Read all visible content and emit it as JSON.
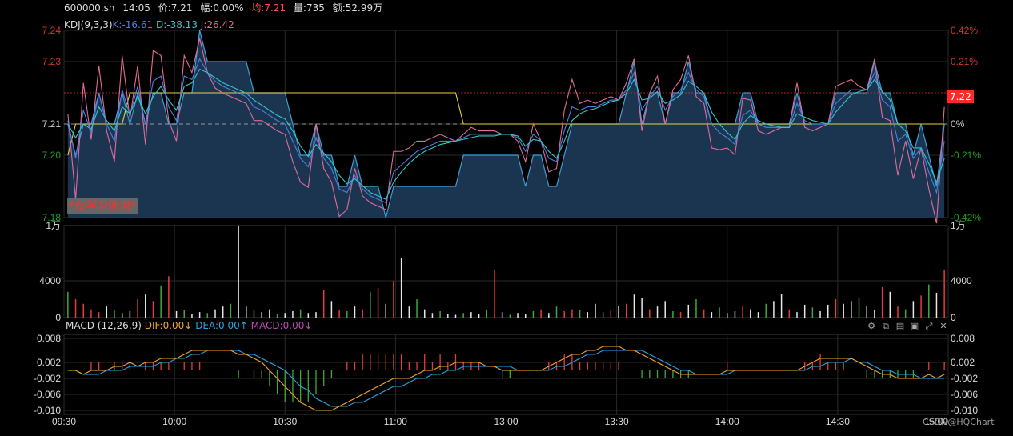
{
  "header": {
    "symbol": "600000.sh",
    "time": "14:05",
    "price": "价:7.21",
    "change": "幅:0.00%",
    "avg": "均:7.21",
    "volume": "量:735",
    "amount": "额:52.99万"
  },
  "kdj": {
    "title": "KDJ(9,3,3)",
    "k": "K:-16.61",
    "d": "D:-38.13",
    "j": "J:26.42"
  },
  "macd": {
    "title": "MACD (12,26,9)",
    "dif": "DIF:0.00↓",
    "dea": "DEA:0.00↑",
    "macd": "MACD:0.00↓"
  },
  "watermark": "*仅学习使用*",
  "price_tag": "7.22",
  "credit": "CSDN@HQChart",
  "toolbar_icons": [
    "settings-icon",
    "copy-icon",
    "layers-icon",
    "window-icon",
    "expand-icon",
    "close-icon"
  ],
  "colors": {
    "area_fill": "#1b3551",
    "area_line": "#3aa0d8",
    "avg_line": "#e6d23c",
    "k": "#4f7fe0",
    "d": "#33c9c9",
    "j": "#e06c9a",
    "dif": "#f4a62a",
    "dea": "#2aa6e8",
    "up": "#e83b3b",
    "down": "#3fa83f",
    "grid": "#2a2a2a",
    "up_text": "#e03030",
    "down_text": "#21a121"
  },
  "chart_data": [
    {
      "type": "area",
      "name": "price",
      "yticks_left": [
        "7.24",
        "7.23",
        "7.21",
        "7.20",
        "7.18"
      ],
      "yticks_right": [
        "0.42%",
        "0.21%",
        "0%",
        "-0.21%",
        "-0.42%"
      ],
      "ylim": [
        7.18,
        7.24
      ],
      "prev_close": 7.21,
      "last_price_line": 7.22,
      "xticks": [
        "09:30",
        "10:00",
        "10:30",
        "11:00",
        "13:00",
        "13:30",
        "14:00",
        "14:30",
        "15:00"
      ],
      "price": [
        7.21,
        7.2,
        7.21,
        7.21,
        7.22,
        7.21,
        7.21,
        7.22,
        7.21,
        7.22,
        7.21,
        7.22,
        7.22,
        7.21,
        7.21,
        7.22,
        7.22,
        7.24,
        7.23,
        7.23,
        7.23,
        7.23,
        7.23,
        7.23,
        7.22,
        7.22,
        7.22,
        7.22,
        7.22,
        7.21,
        7.2,
        7.2,
        7.21,
        7.2,
        7.2,
        7.19,
        7.19,
        7.2,
        7.19,
        7.19,
        7.19,
        7.18,
        7.19,
        7.19,
        7.19,
        7.19,
        7.19,
        7.19,
        7.19,
        7.19,
        7.19,
        7.2,
        7.2,
        7.2,
        7.2,
        7.2,
        7.2,
        7.2,
        7.2,
        7.19,
        7.2,
        7.2,
        7.19,
        7.19,
        7.2,
        7.21,
        7.21,
        7.21,
        7.21,
        7.21,
        7.21,
        7.21,
        7.22,
        7.23,
        7.21,
        7.22,
        7.22,
        7.21,
        7.22,
        7.22,
        7.23,
        7.22,
        7.22,
        7.21,
        7.21,
        7.21,
        7.21,
        7.22,
        7.22,
        7.21,
        7.21,
        7.21,
        7.21,
        7.21,
        7.22,
        7.21,
        7.21,
        7.21,
        7.21,
        7.22,
        7.22,
        7.22,
        7.22,
        7.22,
        7.23,
        7.22,
        7.22,
        7.21,
        7.21,
        7.2,
        7.21,
        7.2,
        7.19,
        7.21
      ],
      "avg_price": [
        7.2,
        7.21,
        7.21,
        7.21,
        7.21,
        7.21,
        7.21,
        7.21,
        7.22,
        7.22,
        7.22,
        7.22,
        7.22,
        7.22,
        7.22,
        7.22,
        7.22,
        7.22,
        7.22,
        7.22,
        7.22,
        7.22,
        7.22,
        7.22,
        7.22,
        7.22,
        7.22,
        7.22,
        7.22,
        7.22,
        7.22,
        7.22,
        7.22,
        7.22,
        7.22,
        7.22,
        7.22,
        7.22,
        7.22,
        7.22,
        7.22,
        7.22,
        7.22,
        7.22,
        7.22,
        7.22,
        7.22,
        7.22,
        7.22,
        7.22,
        7.22,
        7.21,
        7.21,
        7.21,
        7.21,
        7.21,
        7.21,
        7.21,
        7.21,
        7.21,
        7.21,
        7.21,
        7.21,
        7.21,
        7.21,
        7.21,
        7.21,
        7.21,
        7.21,
        7.21,
        7.21,
        7.21,
        7.21,
        7.21,
        7.21,
        7.21,
        7.21,
        7.21,
        7.21,
        7.21,
        7.21,
        7.21,
        7.21,
        7.21,
        7.21,
        7.21,
        7.21,
        7.21,
        7.21,
        7.21,
        7.21,
        7.21,
        7.21,
        7.21,
        7.21,
        7.21,
        7.21,
        7.21,
        7.21,
        7.21,
        7.21,
        7.21,
        7.21,
        7.21,
        7.21,
        7.21,
        7.21,
        7.21,
        7.21,
        7.21,
        7.21,
        7.21,
        7.21,
        7.21
      ],
      "kdj_k": [
        52,
        30,
        58,
        45,
        68,
        50,
        40,
        70,
        55,
        72,
        50,
        75,
        78,
        60,
        52,
        78,
        76,
        88,
        80,
        75,
        72,
        70,
        68,
        66,
        60,
        58,
        55,
        52,
        50,
        40,
        30,
        25,
        42,
        30,
        24,
        12,
        10,
        20,
        12,
        8,
        6,
        4,
        22,
        26,
        30,
        34,
        36,
        38,
        40,
        40,
        40,
        42,
        44,
        44,
        44,
        44,
        44,
        44,
        42,
        34,
        44,
        40,
        30,
        28,
        46,
        60,
        58,
        60,
        60,
        62,
        64,
        64,
        70,
        80,
        58,
        66,
        72,
        58,
        66,
        70,
        80,
        70,
        66,
        50,
        45,
        42,
        38,
        55,
        58,
        50,
        48,
        48,
        48,
        48,
        62,
        52,
        50,
        50,
        50,
        62,
        66,
        70,
        70,
        70,
        80,
        64,
        60,
        40,
        44,
        30,
        36,
        22,
        10,
        40
      ],
      "kdj_d": [
        50,
        42,
        50,
        47,
        60,
        52,
        46,
        60,
        56,
        66,
        56,
        66,
        72,
        64,
        58,
        72,
        74,
        82,
        80,
        77,
        74,
        72,
        70,
        68,
        64,
        61,
        58,
        55,
        53,
        46,
        37,
        31,
        38,
        33,
        28,
        20,
        15,
        18,
        14,
        10,
        8,
        6,
        16,
        22,
        27,
        31,
        34,
        36,
        38,
        39,
        40,
        41,
        42,
        43,
        43,
        43,
        44,
        44,
        43,
        37,
        41,
        40,
        34,
        30,
        40,
        52,
        56,
        58,
        59,
        61,
        63,
        64,
        68,
        76,
        64,
        65,
        69,
        62,
        64,
        67,
        75,
        72,
        68,
        57,
        50,
        45,
        41,
        50,
        55,
        52,
        50,
        49,
        48,
        48,
        56,
        54,
        52,
        51,
        50,
        57,
        62,
        67,
        69,
        70,
        76,
        69,
        64,
        50,
        46,
        36,
        36,
        27,
        16,
        30
      ],
      "kdj_j": [
        56,
        6,
        74,
        41,
        84,
        46,
        28,
        90,
        53,
        84,
        38,
        93,
        90,
        52,
        40,
        90,
        80,
        100,
        80,
        71,
        68,
        66,
        64,
        62,
        52,
        52,
        49,
        46,
        44,
        28,
        16,
        13,
        50,
        24,
        16,
        -4,
        0,
        24,
        8,
        4,
        2,
        0,
        34,
        34,
        36,
        40,
        40,
        42,
        44,
        42,
        40,
        44,
        48,
        46,
        46,
        46,
        44,
        44,
        40,
        28,
        50,
        40,
        22,
        24,
        58,
        76,
        62,
        64,
        62,
        64,
        66,
        64,
        74,
        88,
        46,
        68,
        78,
        50,
        70,
        76,
        90,
        66,
        62,
        36,
        35,
        36,
        32,
        65,
        64,
        46,
        44,
        46,
        48,
        48,
        74,
        48,
        46,
        48,
        50,
        72,
        74,
        76,
        72,
        70,
        88,
        54,
        52,
        20,
        40,
        18,
        36,
        12,
        -8,
        60
      ]
    },
    {
      "type": "bar",
      "name": "volume",
      "yticks": [
        "1万",
        "4000",
        "0"
      ],
      "ylim": [
        0,
        10000
      ],
      "values": [
        2800,
        2000,
        1500,
        900,
        600,
        1200,
        800,
        500,
        700,
        2000,
        2500,
        1800,
        3500,
        4500,
        700,
        800,
        400,
        600,
        500,
        900,
        1200,
        1500,
        10000,
        1200,
        800,
        600,
        900,
        400,
        500,
        700,
        900,
        500,
        600,
        3000,
        1800,
        800,
        700,
        1200,
        900,
        2800,
        3200,
        1500,
        4000,
        6500,
        1200,
        2000,
        900,
        500,
        700,
        400,
        300,
        500,
        600,
        400,
        800,
        5200,
        600,
        300,
        500,
        400,
        700,
        900,
        500,
        1200,
        700,
        900,
        800,
        600,
        1500,
        600,
        800,
        1300,
        1500,
        2500,
        2100,
        900,
        1200,
        1800,
        700,
        600,
        1400,
        2000,
        900,
        600,
        1100,
        500,
        700,
        1300,
        900,
        600,
        1500,
        1800,
        2600,
        900,
        600,
        1400,
        1100,
        700,
        1400,
        2000,
        1500,
        1800,
        2200,
        1300,
        800,
        3300,
        2800,
        1200,
        900,
        1800,
        2400,
        3600,
        2700,
        5200
      ],
      "up": [
        false,
        true,
        true,
        true,
        true,
        false,
        false,
        false,
        false,
        true,
        false,
        true,
        false,
        true,
        false,
        false,
        false,
        false,
        false,
        false,
        false,
        false,
        false,
        false,
        false,
        false,
        false,
        false,
        false,
        false,
        false,
        false,
        false,
        true,
        false,
        true,
        false,
        false,
        true,
        false,
        true,
        false,
        true,
        false,
        false,
        false,
        false,
        false,
        false,
        false,
        false,
        false,
        false,
        false,
        false,
        true,
        false,
        false,
        false,
        false,
        false,
        true,
        false,
        false,
        true,
        true,
        false,
        false,
        false,
        false,
        true,
        false,
        true,
        false,
        false,
        true,
        false,
        false,
        false,
        true,
        false,
        false,
        true,
        false,
        false,
        false,
        false,
        true,
        false,
        false,
        false,
        false,
        false,
        true,
        false,
        false,
        false,
        false,
        false,
        true,
        false,
        false,
        false,
        false,
        false,
        true,
        false,
        true,
        false,
        false,
        true,
        false,
        false,
        true
      ]
    },
    {
      "type": "line",
      "name": "macd",
      "yticks": [
        "0.008",
        "0.002",
        "-0.002",
        "-0.006",
        "-0.010"
      ],
      "ylim": [
        -0.011,
        0.009
      ],
      "dif": [
        0.0,
        0.0,
        -0.001,
        0.0,
        0.0,
        0.0,
        0.001,
        0.001,
        0.002,
        0.001,
        0.002,
        0.002,
        0.003,
        0.003,
        0.003,
        0.004,
        0.005,
        0.005,
        0.005,
        0.005,
        0.005,
        0.005,
        0.004,
        0.004,
        0.003,
        0.002,
        0.0,
        -0.002,
        -0.004,
        -0.006,
        -0.008,
        -0.009,
        -0.01,
        -0.01,
        -0.01,
        -0.009,
        -0.008,
        -0.007,
        -0.006,
        -0.005,
        -0.004,
        -0.003,
        -0.002,
        -0.002,
        -0.002,
        -0.001,
        0.0,
        0.0,
        0.001,
        0.001,
        0.002,
        0.002,
        0.002,
        0.002,
        0.001,
        0.001,
        0.0,
        0.0,
        0.0,
        0.0,
        0.0,
        0.0,
        0.001,
        0.002,
        0.003,
        0.004,
        0.004,
        0.005,
        0.005,
        0.006,
        0.006,
        0.006,
        0.005,
        0.005,
        0.004,
        0.003,
        0.002,
        0.001,
        0.0,
        -0.001,
        -0.001,
        -0.001,
        -0.001,
        -0.001,
        -0.001,
        0.0,
        0.0,
        0.0,
        0.0,
        0.0,
        0.0,
        0.0,
        0.0,
        0.0,
        0.0,
        0.001,
        0.002,
        0.003,
        0.003,
        0.003,
        0.003,
        0.003,
        0.002,
        0.001,
        0.0,
        -0.001,
        -0.001,
        -0.002,
        -0.002,
        -0.002,
        -0.002,
        -0.001,
        -0.002,
        -0.001
      ],
      "dea": [
        0.0,
        0.0,
        -0.001,
        -0.001,
        -0.001,
        0.0,
        0.0,
        0.0,
        0.001,
        0.001,
        0.001,
        0.001,
        0.002,
        0.002,
        0.003,
        0.003,
        0.004,
        0.004,
        0.005,
        0.005,
        0.005,
        0.005,
        0.005,
        0.004,
        0.004,
        0.003,
        0.002,
        0.001,
        0.0,
        -0.002,
        -0.004,
        -0.005,
        -0.007,
        -0.008,
        -0.009,
        -0.009,
        -0.009,
        -0.008,
        -0.008,
        -0.007,
        -0.006,
        -0.005,
        -0.004,
        -0.004,
        -0.003,
        -0.002,
        -0.002,
        -0.001,
        -0.001,
        0.0,
        0.0,
        0.001,
        0.001,
        0.001,
        0.001,
        0.001,
        0.001,
        0.001,
        0.0,
        0.0,
        0.0,
        0.0,
        0.0,
        0.001,
        0.001,
        0.002,
        0.003,
        0.004,
        0.004,
        0.005,
        0.005,
        0.005,
        0.005,
        0.005,
        0.005,
        0.004,
        0.003,
        0.002,
        0.001,
        0.0,
        0.0,
        -0.001,
        -0.001,
        -0.001,
        -0.001,
        -0.001,
        0.0,
        0.0,
        0.0,
        0.0,
        0.0,
        0.0,
        0.0,
        0.0,
        0.0,
        0.0,
        0.001,
        0.001,
        0.002,
        0.002,
        0.002,
        0.003,
        0.002,
        0.002,
        0.001,
        0.0,
        0.0,
        -0.001,
        -0.001,
        -0.001,
        -0.002,
        -0.002,
        -0.002,
        -0.002
      ],
      "hist": [
        0.0,
        0.0,
        0.0,
        0.002,
        0.002,
        0.0,
        0.002,
        0.002,
        0.002,
        0.0,
        0.002,
        0.002,
        0.002,
        0.002,
        0.0,
        0.002,
        0.002,
        0.002,
        0.0,
        0.0,
        0.0,
        0.0,
        -0.002,
        0.0,
        -0.002,
        -0.002,
        -0.004,
        -0.006,
        -0.008,
        -0.008,
        -0.008,
        -0.008,
        -0.006,
        -0.004,
        -0.002,
        0.0,
        0.002,
        0.002,
        0.004,
        0.004,
        0.004,
        0.004,
        0.004,
        0.004,
        0.002,
        0.002,
        0.004,
        0.002,
        0.004,
        0.002,
        0.004,
        0.002,
        0.002,
        0.002,
        0.0,
        0.0,
        -0.002,
        -0.002,
        0.0,
        0.0,
        0.0,
        0.0,
        0.002,
        0.002,
        0.004,
        0.004,
        0.002,
        0.002,
        0.002,
        0.002,
        0.002,
        0.002,
        0.0,
        0.0,
        -0.002,
        -0.002,
        -0.002,
        -0.002,
        -0.002,
        -0.002,
        -0.002,
        0.0,
        0.0,
        0.0,
        0.0,
        0.002,
        0.0,
        0.0,
        0.0,
        0.0,
        0.0,
        0.0,
        0.0,
        0.0,
        0.0,
        0.002,
        0.002,
        0.004,
        0.002,
        0.002,
        0.002,
        0.0,
        0.0,
        -0.002,
        -0.002,
        -0.002,
        -0.002,
        -0.002,
        -0.002,
        -0.002,
        0.0,
        0.002,
        0.0,
        0.002
      ]
    }
  ]
}
